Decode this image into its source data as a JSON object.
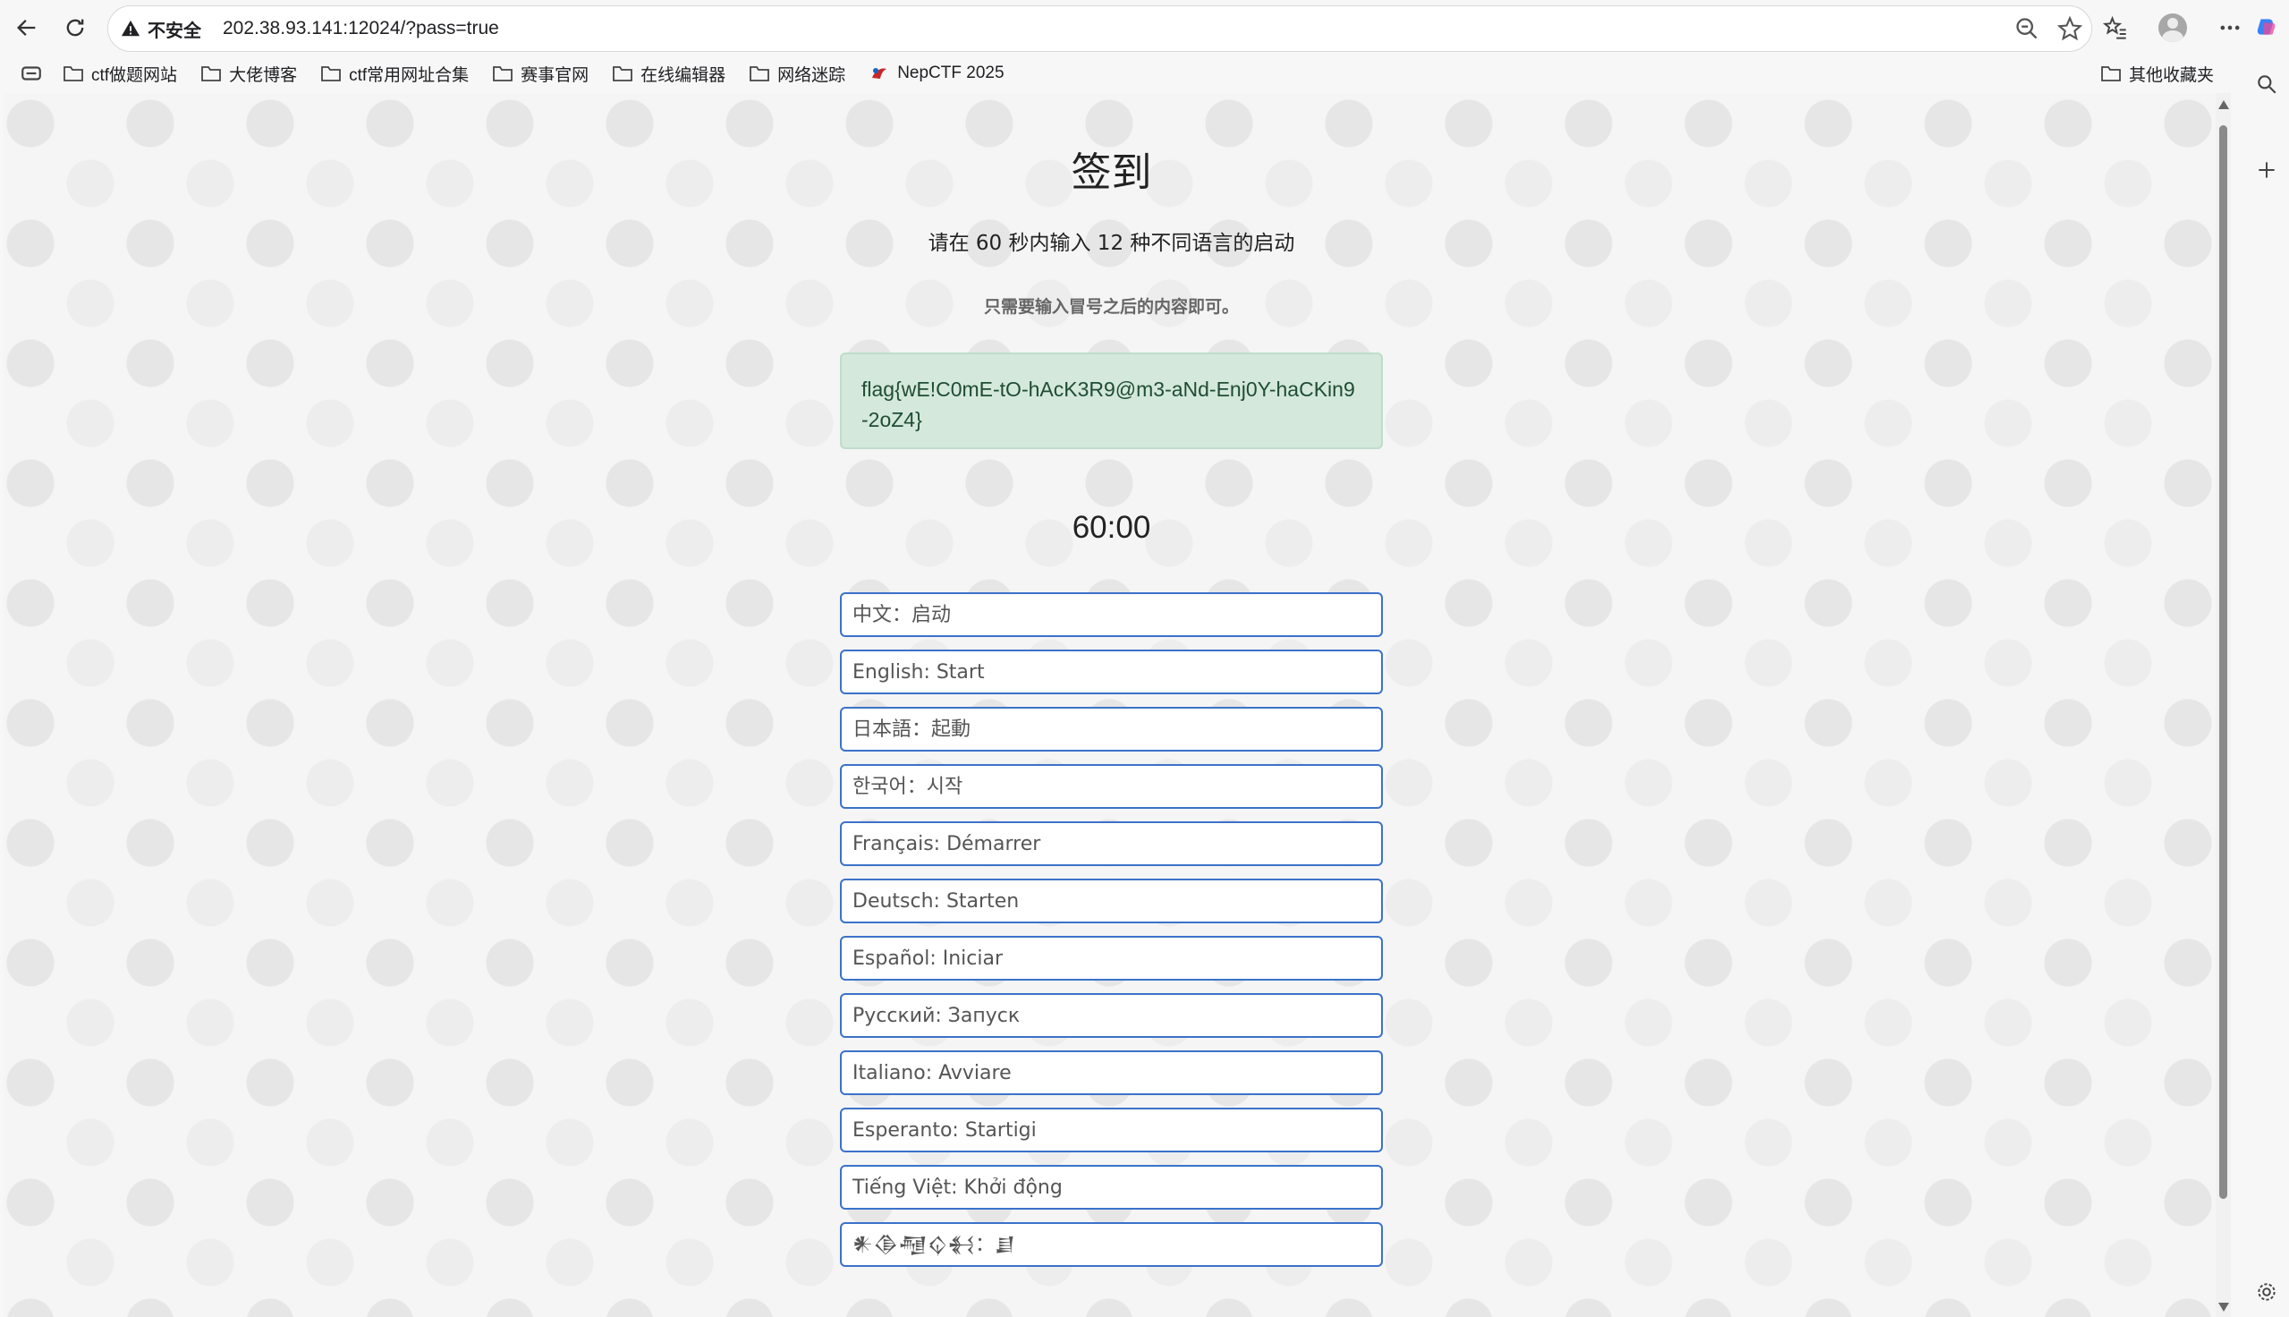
{
  "browser": {
    "security_label": "不安全",
    "url": "202.38.93.141:12024/?pass=true",
    "bookmarks": [
      {
        "label": "ctf做题网站",
        "icon": "folder-icon"
      },
      {
        "label": "大佬博客",
        "icon": "folder-icon"
      },
      {
        "label": "ctf常用网址合集",
        "icon": "folder-icon"
      },
      {
        "label": "赛事官网",
        "icon": "folder-icon"
      },
      {
        "label": "在线编辑器",
        "icon": "folder-icon"
      },
      {
        "label": "网络迷踪",
        "icon": "folder-icon"
      },
      {
        "label": "NepCTF 2025",
        "icon": "site-favicon"
      }
    ],
    "other_bookmarks": "其他收藏夹"
  },
  "page": {
    "title": "签到",
    "subtitle": "请在 60 秒内输入 12 种不同语言的启动",
    "hint": "只需要输入冒号之后的内容即可。",
    "flag": "flag{wE!C0mE-tO-hAcK3R9@m3-aNd-Enj0Y-haCKin9-2oZ4}",
    "timer": "60:00",
    "inputs": [
      {
        "placeholder": "中文：启动",
        "value": ""
      },
      {
        "placeholder": "English: Start",
        "value": ""
      },
      {
        "placeholder": "日本語：起動",
        "value": ""
      },
      {
        "placeholder": "한국어：시작",
        "value": ""
      },
      {
        "placeholder": "Français: Démarrer",
        "value": ""
      },
      {
        "placeholder": "Deutsch: Starten",
        "value": ""
      },
      {
        "placeholder": "Español: Iniciar",
        "value": ""
      },
      {
        "placeholder": "Русский: Запуск",
        "value": ""
      },
      {
        "placeholder": "Italiano: Avviare",
        "value": ""
      },
      {
        "placeholder": "Esperanto: Startigi",
        "value": ""
      },
      {
        "placeholder": "Tiếng Việt: Khởi động",
        "value": ""
      },
      {
        "placeholder": "𒀭𒆠𒆷𒌒𒈬：𒋗",
        "value": ""
      }
    ]
  },
  "colors": {
    "flag_bg": "#d4e8dc",
    "input_border": "#3b72c9"
  }
}
